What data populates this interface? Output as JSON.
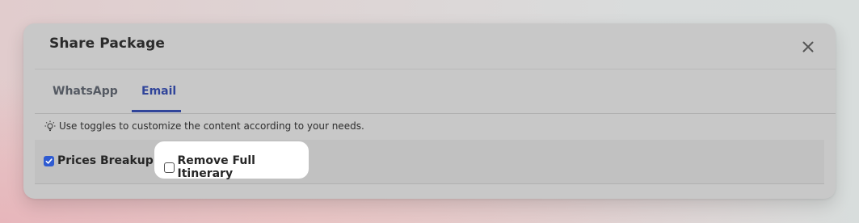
{
  "modal": {
    "title": "Share Package",
    "close_icon": "close-icon"
  },
  "tabs": [
    {
      "label": "WhatsApp",
      "active": false
    },
    {
      "label": "Email",
      "active": true
    }
  ],
  "hint": {
    "icon": "lightbulb-icon",
    "text": "Use toggles to customize the content according to your needs."
  },
  "options": [
    {
      "label": "Prices Breakup",
      "checked": true
    },
    {
      "label": "Remove Full Itinerary",
      "checked": false,
      "highlighted": true
    }
  ],
  "colors": {
    "accent": "#31459a",
    "checkbox": "#2f5bd1",
    "modal_bg": "#c8c8c8"
  }
}
